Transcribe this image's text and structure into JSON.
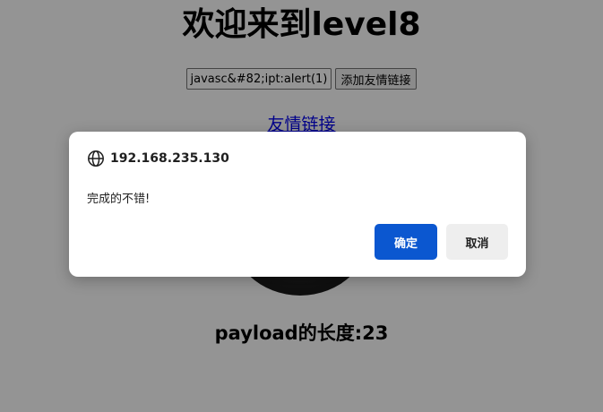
{
  "page": {
    "title": "欢迎来到level8",
    "keyword_input_value": "javasc&#82;ipt:alert(1)",
    "add_button_label": "添加友情链接",
    "friend_link_text": "友情链接",
    "payload_length_text": "payload的长度:23"
  },
  "dialog": {
    "origin": "192.168.235.130",
    "message": "完成的不错!",
    "ok_label": "确定",
    "cancel_label": "取消",
    "globe_icon": "globe-icon"
  },
  "colors": {
    "ok_button": "#0b57d0",
    "link": "#0000ee"
  }
}
